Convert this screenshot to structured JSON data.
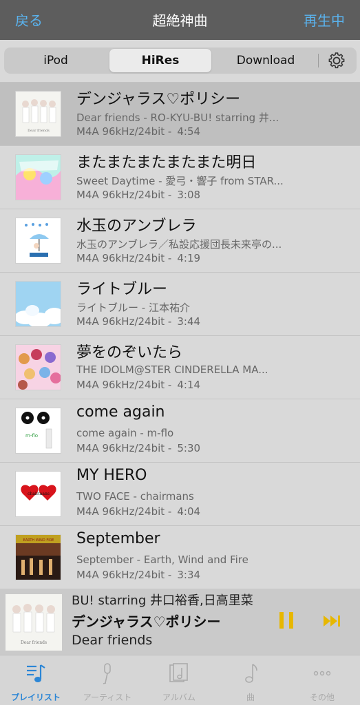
{
  "nav": {
    "back_label": "戻る",
    "title": "超絶神曲",
    "now_playing_label": "再生中"
  },
  "segments": {
    "items": [
      "iPod",
      "HiRes",
      "Download"
    ],
    "selected": "HiRes",
    "settings_icon": "gear-icon"
  },
  "tracks": [
    {
      "title": "デンジャラス♡ポリシー",
      "subtitle": "Dear friends - RO-KYU-BU! starring 井...",
      "format": "M4A 96kHz/24bit -",
      "duration": "4:54",
      "selected": true
    },
    {
      "title": "またまたまたまたまた明日",
      "subtitle": "Sweet Daytime - 愛弓・響子 from STAR...",
      "format": "M4A 96kHz/24bit -",
      "duration": "3:08"
    },
    {
      "title": "水玉のアンブレラ",
      "subtitle": "水玉のアンブレラ／私設応援団長未来亭の...",
      "format": "M4A 96kHz/24bit -",
      "duration": "4:19"
    },
    {
      "title": "ライトブルー",
      "subtitle": "ライトブルー - 江本祐介",
      "format": "M4A 96kHz/24bit -",
      "duration": "3:44"
    },
    {
      "title": "夢をのぞいたら",
      "subtitle": "THE IDOLM@STER CINDERELLA MA...",
      "format": "M4A 96kHz/24bit -",
      "duration": "4:14"
    },
    {
      "title": "come again",
      "subtitle": "come again - m-flo",
      "format": "M4A 96kHz/24bit -",
      "duration": "5:30"
    },
    {
      "title": "MY HERO",
      "subtitle": "TWO FACE - chairmans",
      "format": "M4A 96kHz/24bit -",
      "duration": "4:04"
    },
    {
      "title": "September",
      "subtitle": "September - Earth, Wind and Fire",
      "format": "M4A 96kHz/24bit -",
      "duration": "3:34"
    }
  ],
  "mini_player": {
    "scroll_text": "BU! starring 井口裕香,日高里菜",
    "title": "デンジャラス♡ポリシー",
    "artist": "Dear friends",
    "accent_color": "#e7b700"
  },
  "tabbar": {
    "tabs": [
      "プレイリスト",
      "アーティスト",
      "アルバム",
      "曲",
      "その他"
    ],
    "active": "プレイリスト",
    "active_color": "#2b86d6"
  }
}
